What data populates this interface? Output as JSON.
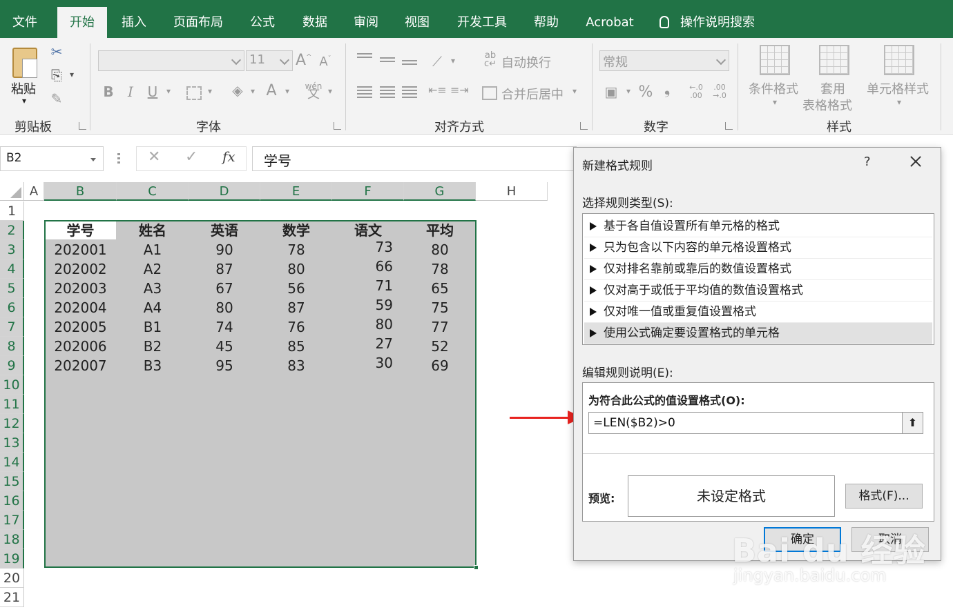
{
  "tabs": [
    {
      "label": "文件",
      "active": false
    },
    {
      "label": "开始",
      "active": true
    },
    {
      "label": "插入",
      "active": false
    },
    {
      "label": "页面布局",
      "active": false
    },
    {
      "label": "公式",
      "active": false
    },
    {
      "label": "数据",
      "active": false
    },
    {
      "label": "审阅",
      "active": false
    },
    {
      "label": "视图",
      "active": false
    },
    {
      "label": "开发工具",
      "active": false
    },
    {
      "label": "帮助",
      "active": false
    },
    {
      "label": "Acrobat",
      "active": false
    }
  ],
  "tell_me": {
    "label": "操作说明搜索",
    "icon": "lightbulb-icon"
  },
  "ribbon": {
    "clipboard": {
      "group_label": "剪贴板",
      "paste_label": "粘贴"
    },
    "font": {
      "group_label": "字体",
      "size_value": "11"
    },
    "alignment": {
      "group_label": "对齐方式",
      "wrap_label": "自动换行",
      "merge_label": "合并后居中"
    },
    "number": {
      "group_label": "数字",
      "format_value": "常规",
      "percent": "%",
      "comma": "❟",
      "inc_decimal": "←.0 .00",
      "dec_decimal": ".00 →.0"
    },
    "styles": {
      "group_label": "样式",
      "conditional_label": "条件格式",
      "table_label_1": "套用",
      "table_label_2": "表格格式",
      "cell_styles_label": "单元格样式"
    }
  },
  "formula_bar": {
    "name_box": "B2",
    "content": "学号",
    "fx": "fx"
  },
  "sheet": {
    "columns": [
      "A",
      "B",
      "C",
      "D",
      "E",
      "F",
      "G",
      "H"
    ],
    "rows": [
      "1",
      "2",
      "3",
      "4",
      "5",
      "6",
      "7",
      "8",
      "9",
      "10",
      "11",
      "12",
      "13",
      "14",
      "15",
      "16",
      "17",
      "18",
      "19",
      "20",
      "21"
    ],
    "table": {
      "headers": [
        "学号",
        "姓名",
        "英语",
        "数学",
        "语文",
        "平均"
      ],
      "rows": [
        [
          "202001",
          "A1",
          "90",
          "78",
          "73",
          "80"
        ],
        [
          "202002",
          "A2",
          "87",
          "80",
          "66",
          "78"
        ],
        [
          "202003",
          "A3",
          "67",
          "56",
          "71",
          "65"
        ],
        [
          "202004",
          "A4",
          "80",
          "87",
          "59",
          "75"
        ],
        [
          "202005",
          "B1",
          "74",
          "76",
          "80",
          "77"
        ],
        [
          "202006",
          "B2",
          "45",
          "85",
          "27",
          "52"
        ],
        [
          "202007",
          "B3",
          "95",
          "83",
          "30",
          "69"
        ]
      ]
    }
  },
  "dialog": {
    "title": "新建格式规则",
    "help": "?",
    "select_type_label": "选择规则类型(S):",
    "rule_types": [
      "基于各自值设置所有单元格的格式",
      "只为包含以下内容的单元格设置格式",
      "仅对排名靠前或靠后的数值设置格式",
      "仅对高于或低于平均值的数值设置格式",
      "仅对唯一值或重复值设置格式",
      "使用公式确定要设置格式的单元格"
    ],
    "selected_rule_index": 5,
    "edit_desc_label": "编辑规则说明(E):",
    "formula_label": "为符合此公式的值设置格式(O):",
    "formula_value": "=LEN($B2)>0",
    "preview_label": "预览:",
    "preview_text": "未设定格式",
    "format_button": "格式(F)...",
    "ok_button": "确定",
    "cancel_button": "取消"
  },
  "watermark": {
    "logo": "Bai du 经验",
    "url": "jingyan.baidu.com"
  },
  "colors": {
    "excel_green": "#217346",
    "arrow_red": "#e8231f",
    "selection_gray": "#c8c8c8"
  }
}
